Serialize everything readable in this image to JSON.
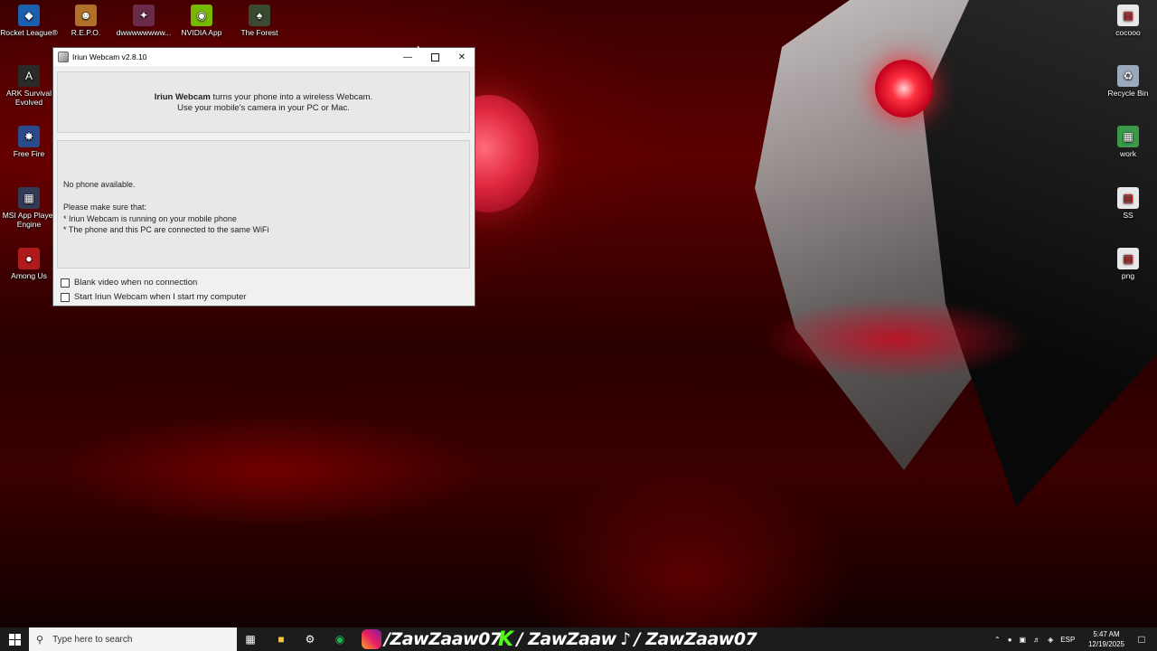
{
  "desktop": {
    "icons_left_top": [
      {
        "label": "Rocket League®",
        "icon": "rocket-league-icon",
        "color": "#1b5fae"
      },
      {
        "label": "R.E.P.O.",
        "icon": "repo-game-icon",
        "color": "#b0702a"
      },
      {
        "label": "dwwwwwwww...",
        "icon": "shortcut-icon",
        "color": "#6a2a4a"
      },
      {
        "label": "NVIDIA App",
        "icon": "nvidia-icon",
        "color": "#76b900"
      },
      {
        "label": "The Forest",
        "icon": "the-forest-icon",
        "color": "#3a4a30"
      }
    ],
    "icons_left_column": [
      {
        "label": "ARK Survival Evolved",
        "icon": "ark-icon",
        "color": "#2a2a2a"
      },
      {
        "label": "Free Fire",
        "icon": "free-fire-icon",
        "color": "#2a4a8a"
      },
      {
        "label": "MSI App Player Engine",
        "icon": "msi-app-player-icon",
        "color": "#333a55"
      },
      {
        "label": "Among Us",
        "icon": "among-us-icon",
        "color": "#b01a1a"
      }
    ],
    "icons_right_column": [
      {
        "label": "cocooo",
        "icon": "file-icon",
        "color": "#e8e8e8"
      },
      {
        "label": "Recycle Bin",
        "icon": "recycle-bin-icon",
        "color": "#9ab"
      },
      {
        "label": "work",
        "icon": "spreadsheet-file-icon",
        "color": "#3a9a4a"
      },
      {
        "label": "SS",
        "icon": "file-icon",
        "color": "#e8e8e8"
      },
      {
        "label": "png",
        "icon": "file-icon",
        "color": "#e8e8e8"
      }
    ]
  },
  "window": {
    "title": "Iriun Webcam v2.8.10",
    "intro_bold": "Iriun Webcam",
    "intro_rest": " turns your phone into a wireless Webcam.",
    "intro_line2": "Use your mobile's camera in your PC or Mac.",
    "status": "No phone available.",
    "checklist_title": "Please make sure that:",
    "check1": "* Iriun Webcam is running on your mobile phone",
    "check2": "* The phone and this PC are connected to the same WiFi",
    "option1": "Blank video when no connection",
    "option2": "Start Iriun Webcam when I start my computer",
    "option1_checked": false,
    "option2_checked": false
  },
  "taskbar": {
    "search_placeholder": "Type here to search",
    "social_instagram": "/ZawZaaw07",
    "social_kick": "/ ZawZaaw",
    "social_tiktok": "/ ZawZaaw07",
    "language": "ESP",
    "time": "5:47 AM",
    "date": "12/19/2025"
  }
}
